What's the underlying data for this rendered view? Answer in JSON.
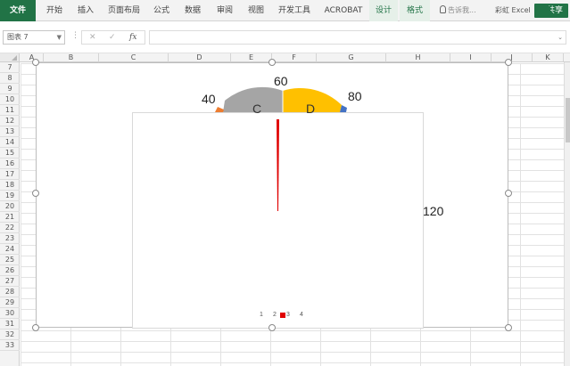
{
  "ribbon": {
    "tabs": [
      {
        "label": "文件"
      },
      {
        "label": "开始"
      },
      {
        "label": "插入"
      },
      {
        "label": "页面布局"
      },
      {
        "label": "公式"
      },
      {
        "label": "数据"
      },
      {
        "label": "审阅"
      },
      {
        "label": "视图"
      },
      {
        "label": "开发工具"
      },
      {
        "label": "ACROBAT"
      },
      {
        "label": "设计"
      },
      {
        "label": "格式"
      }
    ],
    "search_placeholder": "告诉我...",
    "user": "彩虹 Excel",
    "share_label": "共享",
    "accent_color": "#217346"
  },
  "formula_bar": {
    "name_box": "图表 7",
    "fx_label": "fx",
    "cancel_icon": "x-icon",
    "confirm_icon": "check-icon",
    "formula": ""
  },
  "columns": [
    "A",
    "B",
    "C",
    "D",
    "E",
    "F",
    "G",
    "H",
    "I",
    "J",
    "K"
  ],
  "rows": [
    "7",
    "8",
    "9",
    "10",
    "11",
    "12",
    "13",
    "14",
    "15",
    "16",
    "17",
    "18",
    "19",
    "20",
    "21",
    "22",
    "23",
    "24",
    "25",
    "26",
    "27",
    "28",
    "29",
    "30",
    "31",
    "32",
    "33"
  ],
  "chart": {
    "gauge_labels": {
      "v40": "40",
      "v60": "60",
      "v80": "80",
      "v120": "120"
    },
    "segments": [
      {
        "label": "C",
        "color": "#a5a5a5"
      },
      {
        "label": "D",
        "color": "#ffc000"
      }
    ],
    "edge_colors": {
      "left": "#ed7d31",
      "right": "#4472c4"
    },
    "needle_color": "#e00000",
    "legend": [
      "1",
      "2",
      "3",
      "4"
    ]
  }
}
